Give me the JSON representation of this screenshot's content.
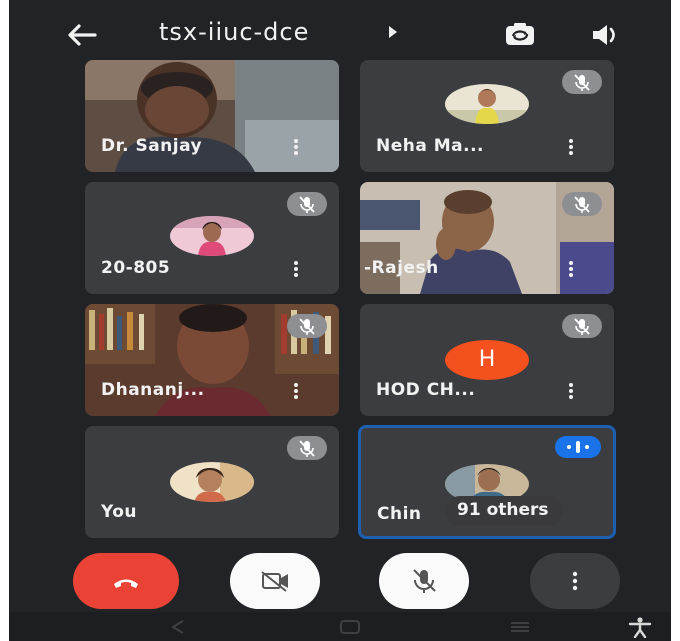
{
  "header": {
    "title": "tsx-iiuc-dce",
    "back_icon": "arrow-left-icon",
    "camera_switch_icon": "camera-flip-icon",
    "speaker_icon": "speaker-icon"
  },
  "participants": [
    {
      "name": "Dr. Sanjay",
      "muted": false,
      "display": "video"
    },
    {
      "name": "Neha Ma...",
      "muted": true,
      "display": "avatar-photo"
    },
    {
      "name": "20-805",
      "muted": true,
      "display": "avatar-photo"
    },
    {
      "name": "-Rajesh",
      "muted": true,
      "display": "video"
    },
    {
      "name": "Dhananj...",
      "muted": true,
      "display": "video"
    },
    {
      "name": "HOD CH...",
      "muted": true,
      "display": "letter-avatar",
      "initial": "H",
      "avatar_color": "#f4511e"
    },
    {
      "name": "You",
      "muted": true,
      "display": "avatar-photo"
    },
    {
      "name": "Chin",
      "muted": false,
      "display": "avatar-photo",
      "speaking": true,
      "others_label": "91 others"
    }
  ],
  "controls": {
    "end_call_icon": "phone-hangup-icon",
    "camera_icon": "camera-off-icon",
    "mic_icon": "mic-off-icon",
    "more_icon": "more-vertical-icon",
    "end_call_color": "#ea4335"
  },
  "colors": {
    "background": "#222326",
    "tile": "#3c3d41",
    "active_border": "#1e5fb0",
    "speaking_badge": "#1a73e8"
  }
}
